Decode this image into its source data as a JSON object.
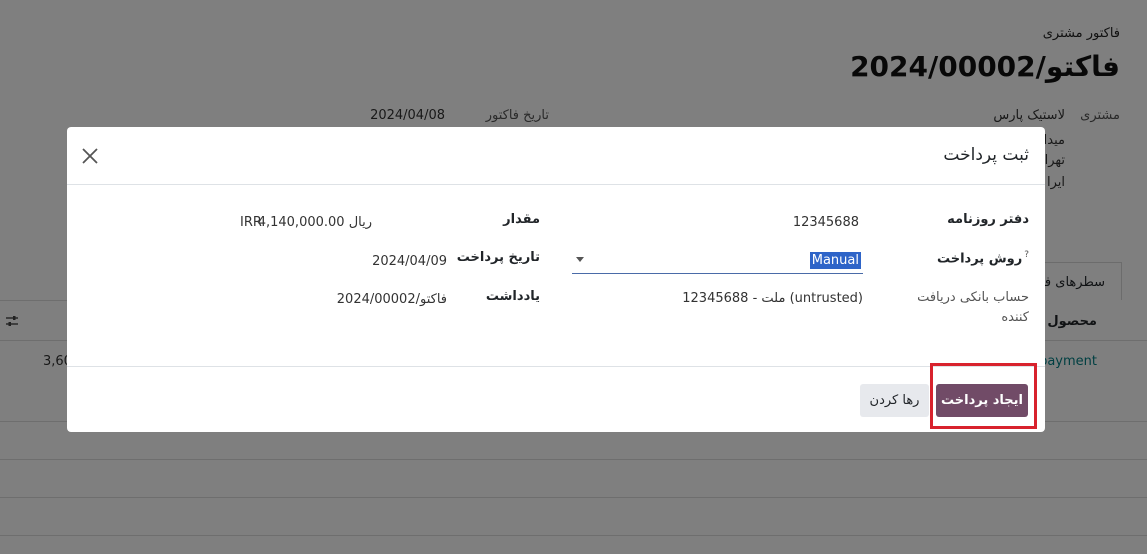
{
  "background": {
    "subtitle": "فاکتور مشتری",
    "title": "فاکتو/2024/00002",
    "customer_label": "مشتری",
    "customer_name": "لاستیک پارس",
    "addr_line1": "میدا",
    "addr_line2": "تهرا",
    "addr_line3": "ایرا",
    "invoice_date_label": "تاریخ فاکتور",
    "invoice_date": "2024/04/08",
    "tab_label": "سطرهای فا",
    "col_product": "محصول",
    "row_link": "payment",
    "row_amount": "3,60"
  },
  "dialog": {
    "title": "ثبت پرداخت",
    "close_icon": "close-icon",
    "journal_label": "دفتر روزنامه",
    "journal_value": "12345688",
    "payment_method_label": "روش پرداخت",
    "payment_method_help": "?",
    "payment_method_value": "Manual",
    "bank_account_label": "حساب بانکی دریافت کننده",
    "bank_account_value": "12345688 - ملت (untrusted)",
    "amount_label": "مقدار",
    "amount_value": "4,140,000.00 ریال",
    "currency": "IRR",
    "payment_date_label": "تاریخ پرداخت",
    "payment_date_value": "2024/04/09",
    "memo_label": "یادداشت",
    "memo_value": "فاکتو/2024/00002",
    "create_button": "ایجاد پرداخت",
    "discard_button": "رها کردن"
  },
  "colors": {
    "primary": "#714b67",
    "highlight": "#d8222d",
    "selection": "#2e64c8"
  }
}
